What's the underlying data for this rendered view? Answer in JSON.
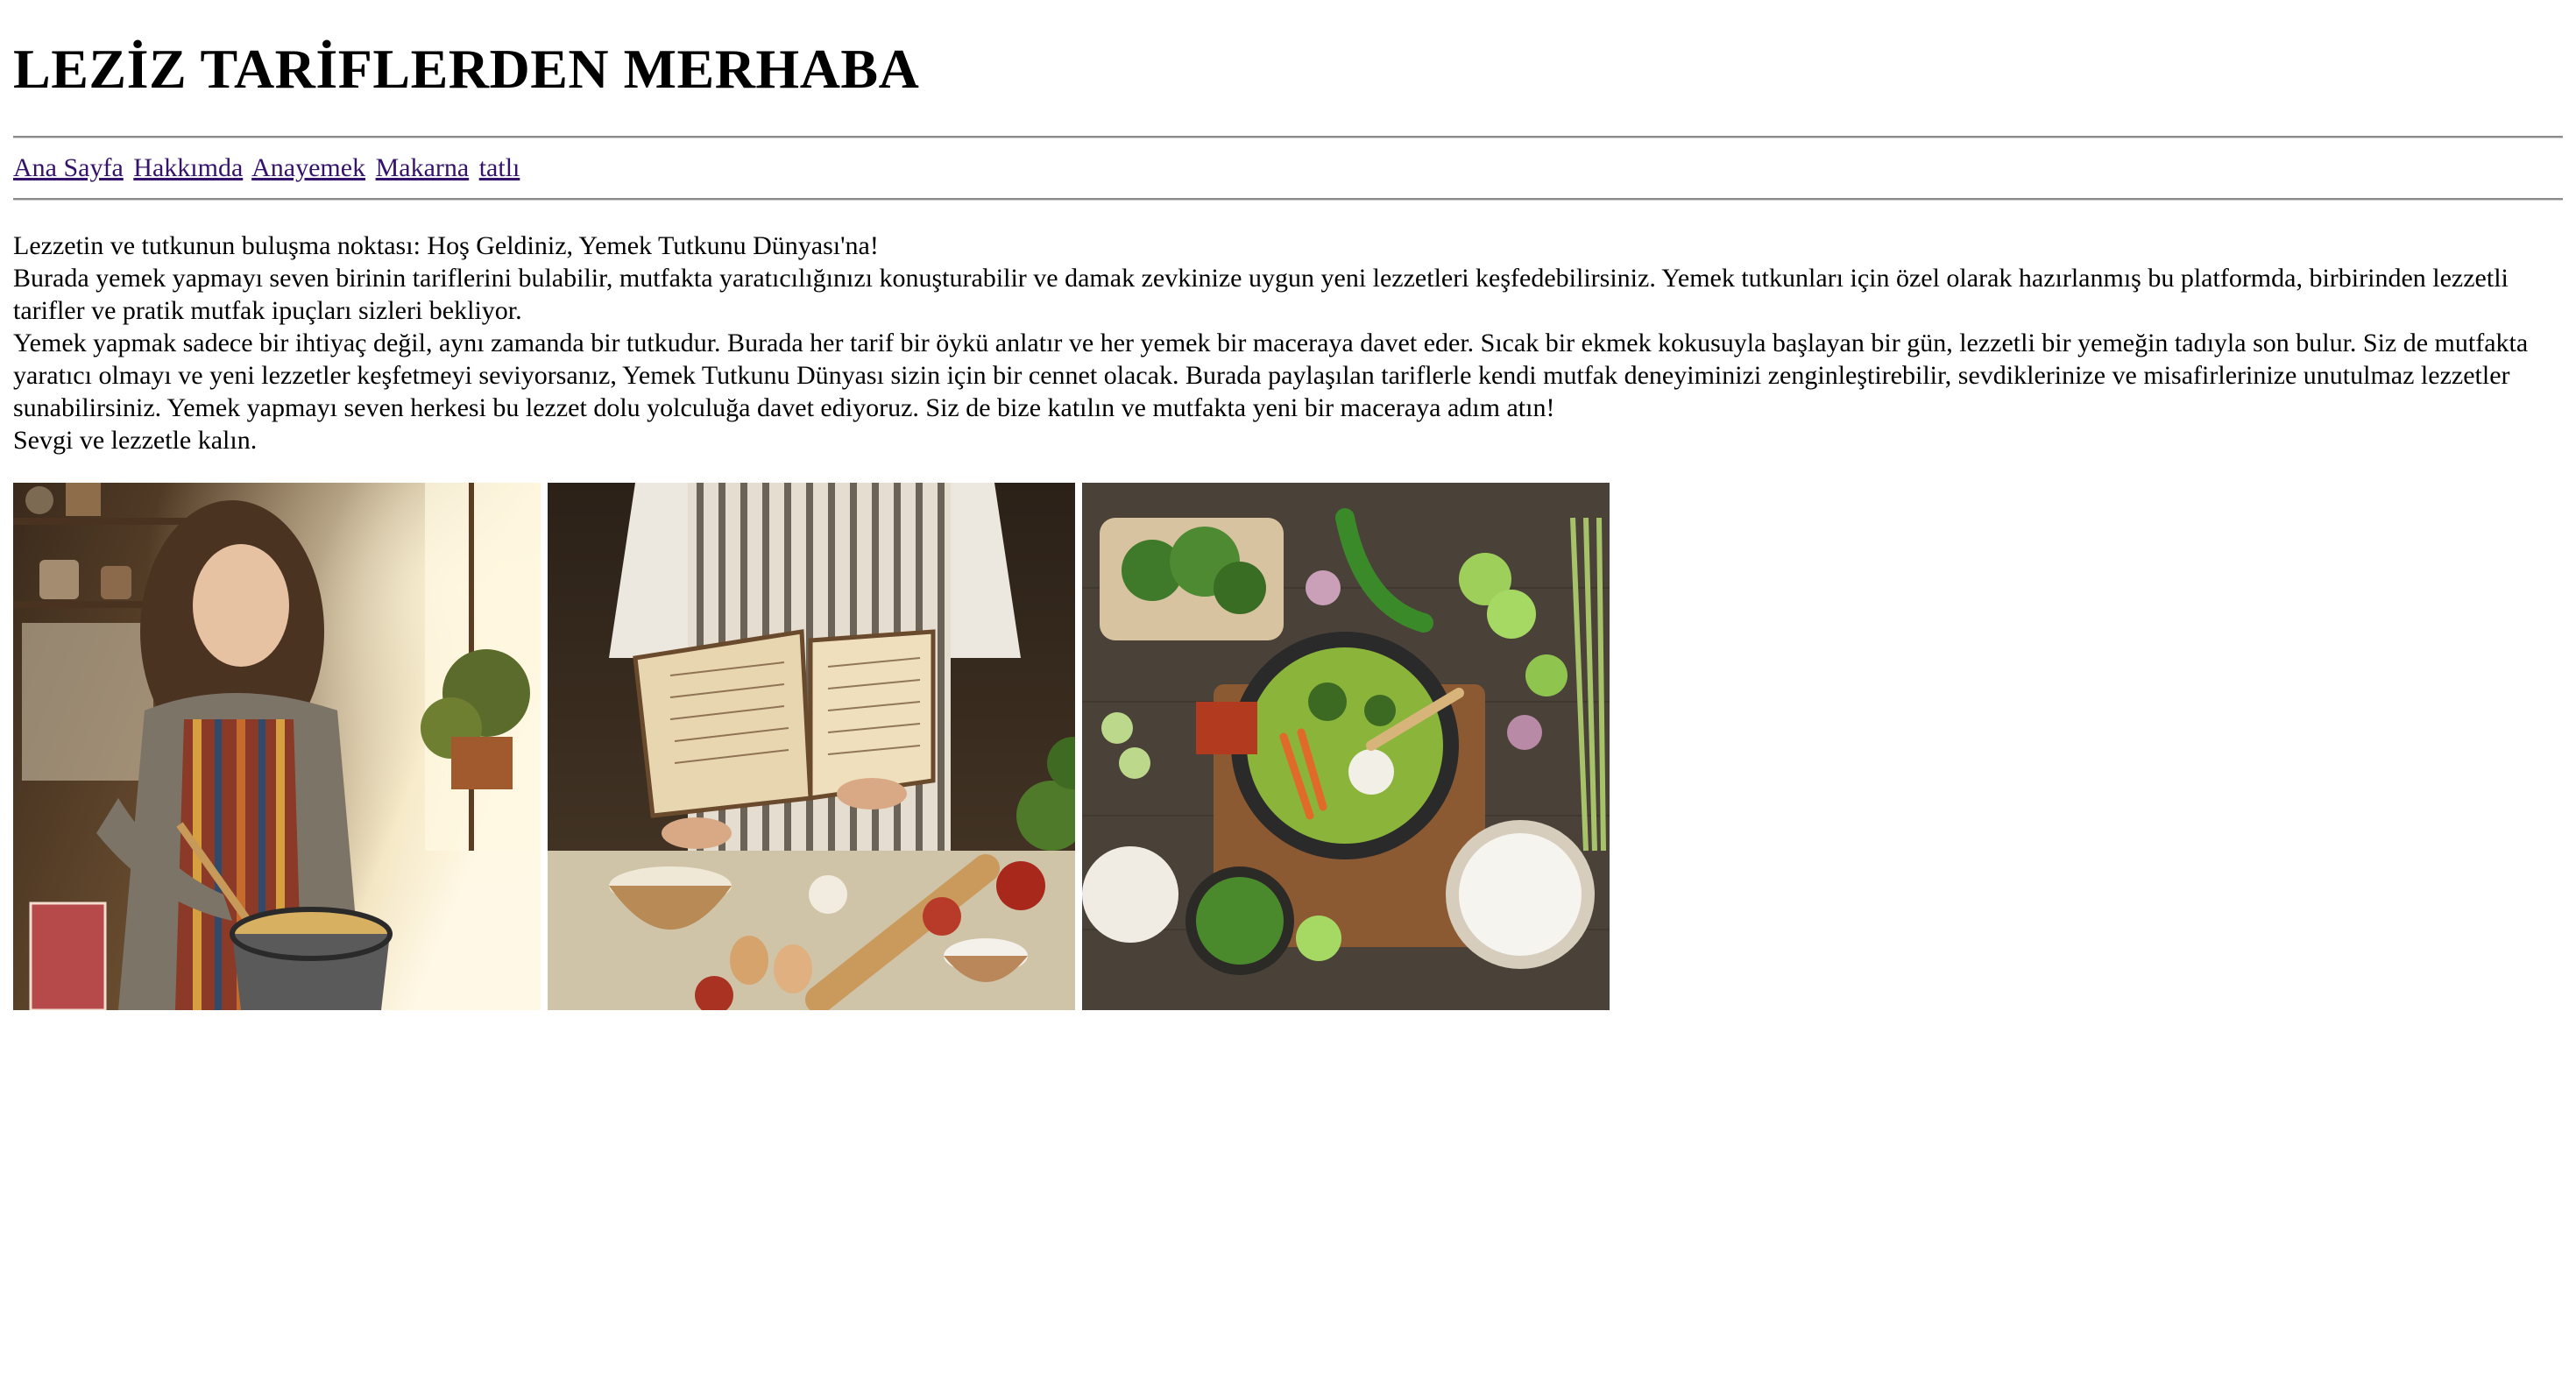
{
  "header": {
    "title": "LEZİZ TARİFLERDEN MERHABA"
  },
  "nav": {
    "items": [
      {
        "label": "Ana Sayfa"
      },
      {
        "label": "Hakkımda"
      },
      {
        "label": "Anayemek"
      },
      {
        "label": "Makarna"
      },
      {
        "label": "tatlı"
      }
    ],
    "link_color": "#35136b"
  },
  "content": {
    "paragraphs": [
      "Lezzetin ve tutkunun buluşma noktası: Hoş Geldiniz, Yemek Tutkunu Dünyası'na!",
      "Burada yemek yapmayı seven birinin tariflerini bulabilir, mutfakta yaratıcılığınızı konuşturabilir ve damak zevkinize uygun yeni lezzetleri keşfedebilirsiniz. Yemek tutkunları için özel olarak hazırlanmış bu platformda, birbirinden lezzetli tarifler ve pratik mutfak ipuçları sizleri bekliyor.",
      "Yemek yapmak sadece bir ihtiyaç değil, aynı zamanda bir tutkudur. Burada her tarif bir öykü anlatır ve her yemek bir maceraya davet eder. Sıcak bir ekmek kokusuyla başlayan bir gün, lezzetli bir yemeğin tadıyla son bulur. Siz de mutfakta yaratıcı olmayı ve yeni lezzetler keşfetmeyi seviyorsanız, Yemek Tutkunu Dünyası sizin için bir cennet olacak. Burada paylaşılan tariflerle kendi mutfak deneyiminizi zenginleştirebilir, sevdiklerinize ve misafirlerinize unutulmaz lezzetler sunabilirsiniz. Yemek yapmayı seven herkesi bu lezzet dolu yolculuğa davet ediyoruz. Siz de bize katılın ve mutfakta yeni bir maceraya adım atın!",
      "Sevgi ve lezzetle kalın."
    ]
  },
  "gallery": {
    "images": [
      {
        "icon": "woman-cooking-photo"
      },
      {
        "icon": "recipe-book-photo"
      },
      {
        "icon": "green-curry-ingredients-photo"
      }
    ]
  }
}
